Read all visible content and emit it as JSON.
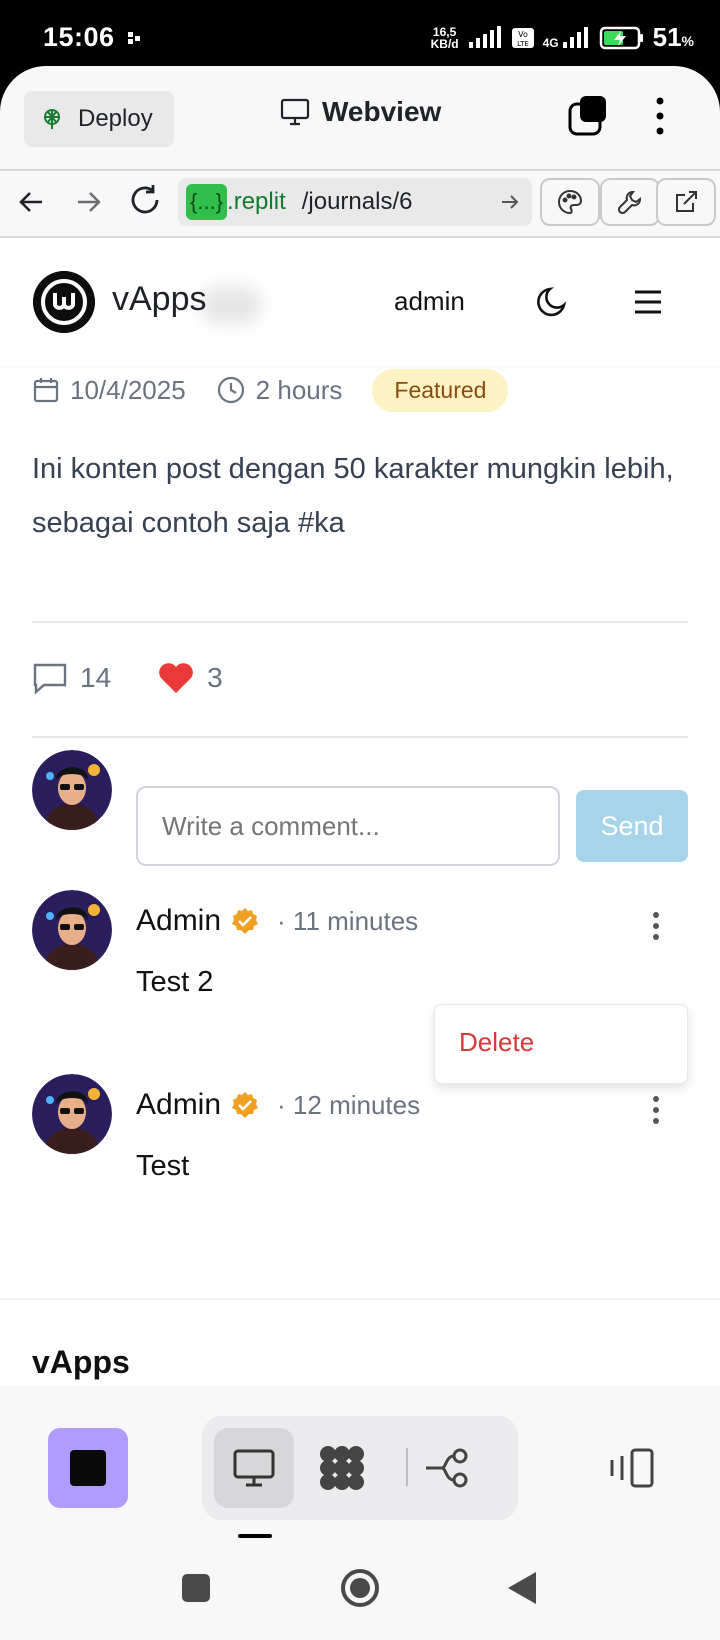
{
  "status_bar": {
    "time": "15:06",
    "speed_top": "16,5",
    "speed_bottom": "KB/d",
    "network": "4G",
    "battery": "51",
    "battery_unit": "%"
  },
  "replit": {
    "deploy_label": "Deploy",
    "webview_label": "Webview",
    "url_badge": "{...}",
    "url_domain": ".replit",
    "url_path": "/journals/6"
  },
  "site": {
    "brand": "vApps",
    "admin_link": "admin",
    "post": {
      "date": "10/4/2025",
      "read_time": "2 hours",
      "badge": "Featured",
      "body": "Ini konten post dengan 50 karakter mungkin lebih, sebagai contoh saja #ka",
      "comments_count": "14",
      "likes_count": "3"
    },
    "comment_form": {
      "placeholder": "Write a comment...",
      "send_label": "Send"
    },
    "comments": [
      {
        "author": "Admin",
        "ago": "· 11 minutes",
        "text": "Test 2"
      },
      {
        "author": "Admin",
        "ago": "· 12 minutes",
        "text": "Test"
      }
    ],
    "dropdown": {
      "delete_label": "Delete"
    },
    "footer_brand": "vApps"
  },
  "colors": {
    "accent_green": "#2fbf4a",
    "featured_bg": "#fdf2c4",
    "send_bg": "#a8d4ea",
    "delete_red": "#d33a3a",
    "stop_purple": "#b09cff",
    "verified_orange": "#f0a020"
  }
}
